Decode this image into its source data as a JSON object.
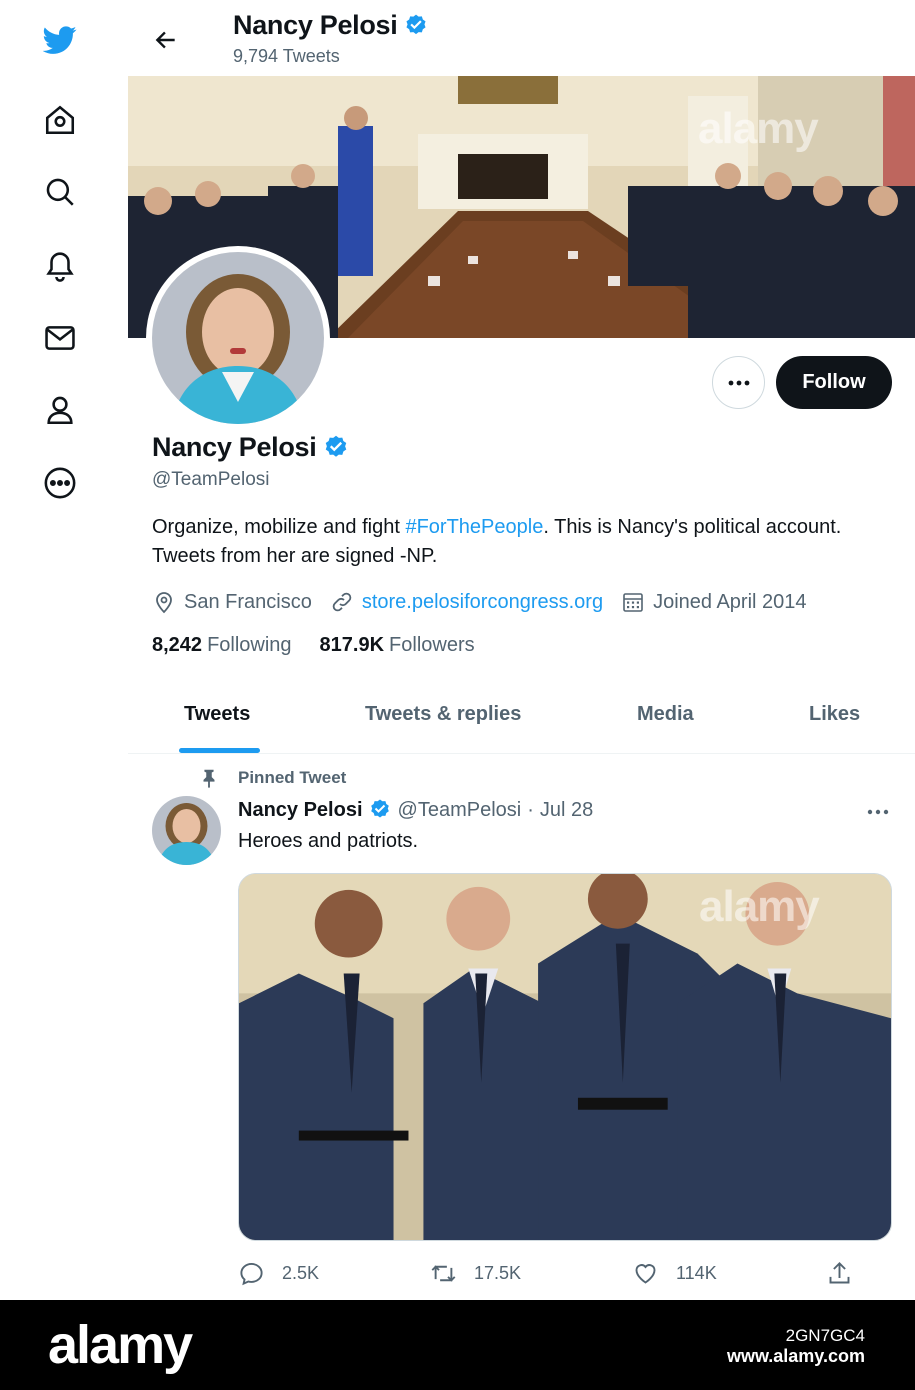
{
  "colors": {
    "accent": "#1d9bf0",
    "text": "#0f1419",
    "muted": "#536471",
    "border": "#cfd9de"
  },
  "sidebar": {
    "icons": [
      "twitter-logo-icon",
      "home-icon",
      "search-icon",
      "bell-icon",
      "mail-icon",
      "profile-icon",
      "more-circle-icon"
    ]
  },
  "header": {
    "name": "Nancy Pelosi",
    "tweet_count": "9,794 Tweets"
  },
  "profile": {
    "name": "Nancy Pelosi",
    "handle": "@TeamPelosi",
    "bio_pre": "Organize, mobilize and fight ",
    "bio_tag": "#ForThePeople",
    "bio_post": ". This is Nancy's political account. Tweets from her are signed -NP.",
    "location": "San Francisco",
    "website": "store.pelosiforcongress.org",
    "joined": "Joined April 2014",
    "following_count": "8,242",
    "following_label": "Following",
    "followers_count": "817.9K",
    "followers_label": "Followers",
    "follow_label": "Follow"
  },
  "tabs": [
    {
      "label": "Tweets",
      "active": true
    },
    {
      "label": "Tweets & replies",
      "active": false
    },
    {
      "label": "Media",
      "active": false
    },
    {
      "label": "Likes",
      "active": false
    }
  ],
  "tweet": {
    "pinned_label": "Pinned Tweet",
    "name": "Nancy Pelosi",
    "handle": "@TeamPelosi",
    "date": "Jul 28",
    "text": "Heroes and patriots.",
    "replies": "2.5K",
    "retweets": "17.5K",
    "likes": "114K"
  },
  "watermark": {
    "text": "alamy",
    "image_id": "2GN7GC4",
    "url": "www.alamy.com"
  }
}
